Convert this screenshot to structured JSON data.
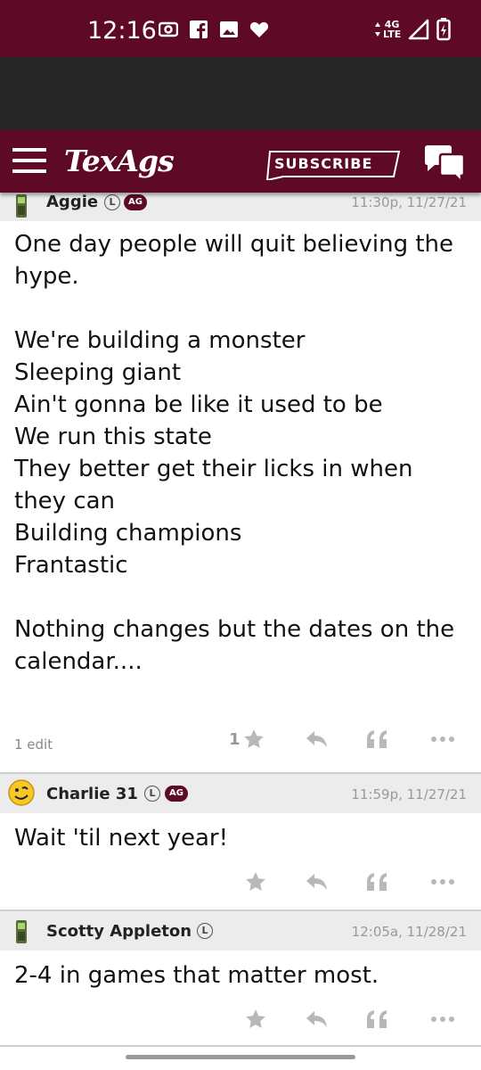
{
  "status_bar": {
    "time": "12:16",
    "network": "4G",
    "network_sub": "LTE"
  },
  "header": {
    "logo": "TexAgs",
    "subscribe_label": "SUBSCRIBE"
  },
  "colors": {
    "brand": "#5e0a26",
    "dark_band": "#262626",
    "post_header_bg": "#ececec",
    "icon_gray": "#b8b8b8"
  },
  "posts": [
    {
      "avatar_icon": "phone-icon",
      "username": "Aggie",
      "badge_l": "L",
      "badge_ag": "AG",
      "timestamp": "11:30p, 11/27/21",
      "body": "One day people will quit believing the hype.\n\nWe're building a monster\nSleeping giant\nAin't gonna be like it used to be\nWe run this state\nThey better get their licks in when they can\nBuilding champions\nFrantastic\n\nNothing changes but the dates on the calendar....",
      "edit_note": "1 edit",
      "star_count": "1"
    },
    {
      "avatar_icon": "smiley-icon",
      "username": "Charlie 31",
      "badge_l": "L",
      "badge_ag": "AG",
      "timestamp": "11:59p, 11/27/21",
      "body": "Wait 'til next year!"
    },
    {
      "avatar_icon": "phone-icon",
      "username": "Scotty Appleton",
      "badge_l": "L",
      "timestamp": "12:05a, 11/28/21",
      "body": "2-4 in games that matter most."
    }
  ]
}
